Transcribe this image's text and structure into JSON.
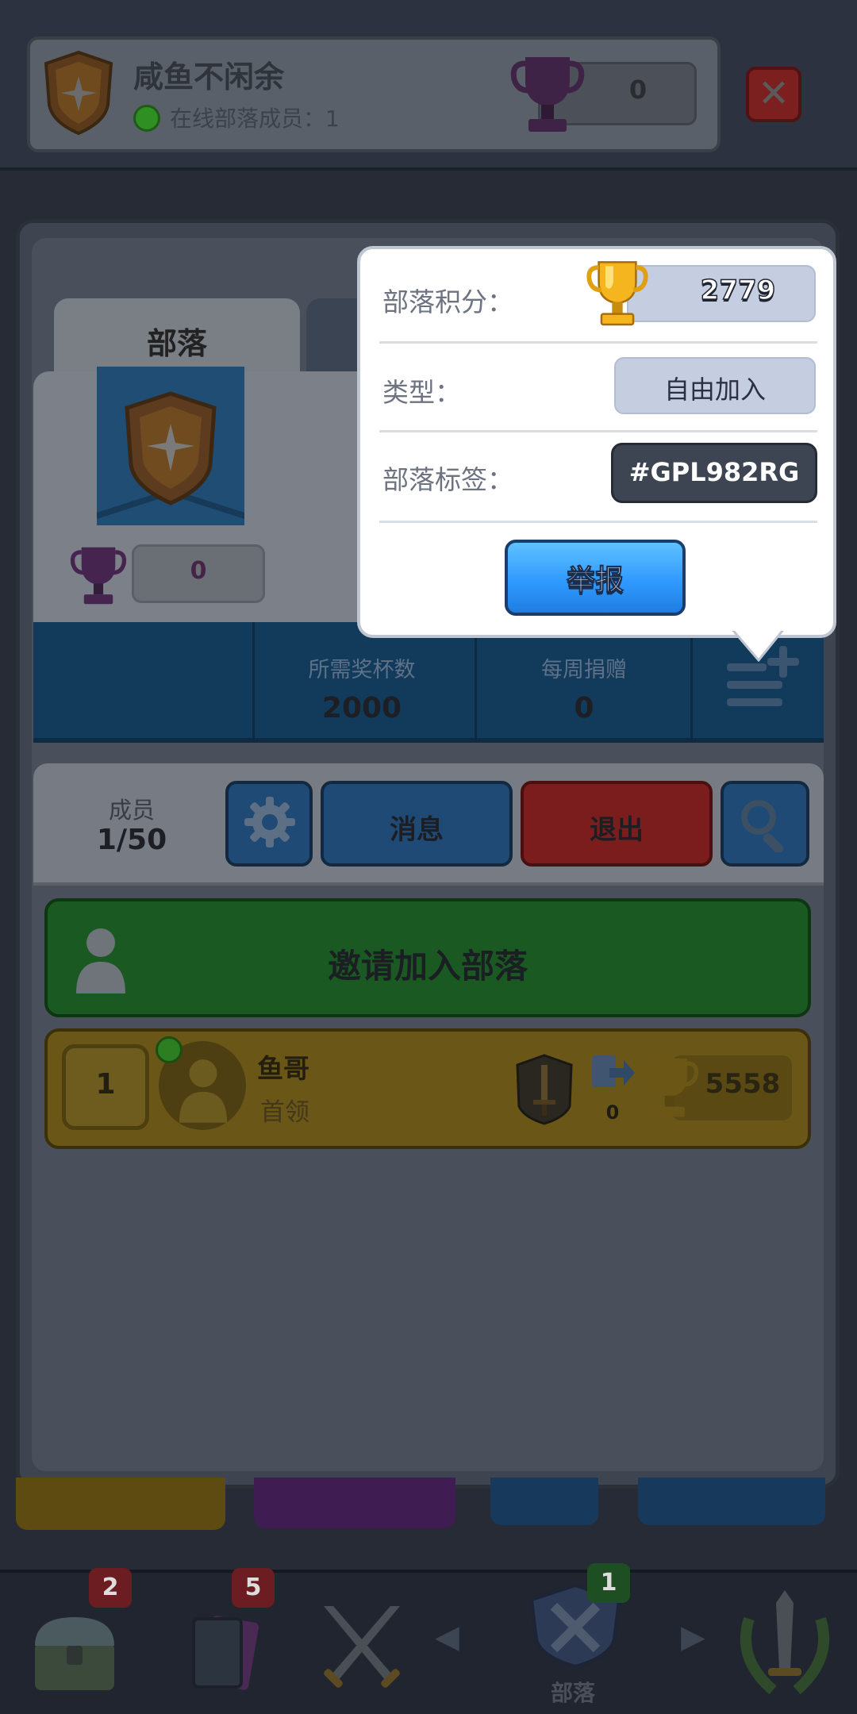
{
  "header": {
    "clan_name": "咸鱼不闲余",
    "online_label": "在线部落成员：1",
    "trophy_value": "0"
  },
  "tabs": [
    {
      "label": "部落"
    },
    {
      "label": ""
    }
  ],
  "clan_info": {
    "trophy_value": "0",
    "stats": [
      {
        "label": "所需奖杯数",
        "value": "2000"
      },
      {
        "label": "每周捐赠",
        "value": "0"
      }
    ]
  },
  "members_bar": {
    "label": "成员",
    "count": "1/50",
    "message_label": "消息",
    "leave_label": "退出"
  },
  "invite": {
    "label": "邀请加入部落"
  },
  "members": [
    {
      "rank": "1",
      "name": "鱼哥",
      "role": "首领",
      "donations": "0",
      "trophies": "5558",
      "online": true
    }
  ],
  "bottom_nav": {
    "badges": {
      "shop": "2",
      "cards": "5",
      "clan": "1"
    },
    "clan_label": "部落"
  },
  "popup": {
    "score_label": "部落积分：",
    "score_value": "2779",
    "type_label": "类型：",
    "type_value": "自由加入",
    "tag_label": "部落标签：",
    "tag_value": "#GPL982RG",
    "report_label": "举报"
  },
  "colors": {
    "popup_bg": "#ffffff",
    "report_button": "#2f9aff",
    "invite_button": "#1a5a22",
    "leave_button": "#7b1d1d",
    "member_row": "#6a5617"
  }
}
